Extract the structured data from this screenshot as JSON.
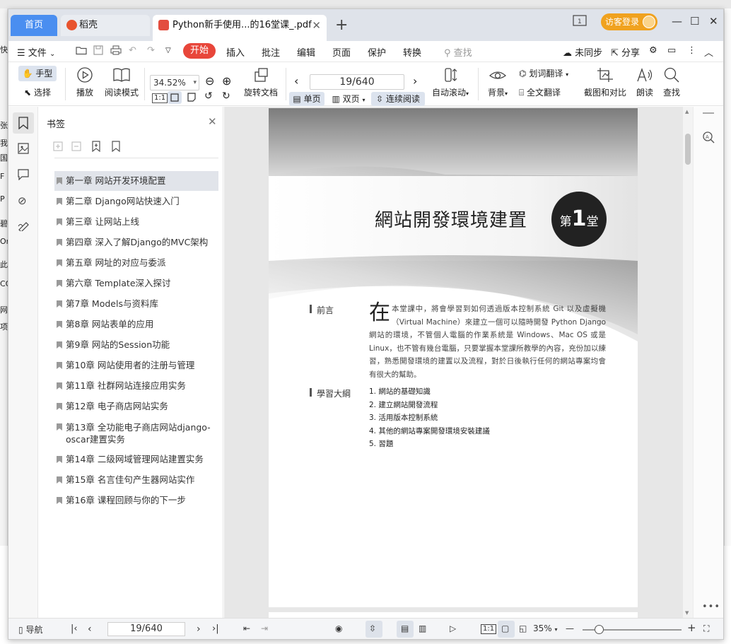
{
  "desktop": {
    "left_chars": [
      "快",
      "张",
      "我",
      "国",
      "F",
      "P",
      "碧",
      "Or",
      "此",
      "CO",
      "网",
      "项"
    ]
  },
  "tabs": [
    {
      "label": "首页"
    },
    {
      "label": "稻壳"
    },
    {
      "label": "Python新手使用...的16堂课_.pdf"
    }
  ],
  "title_bar": {
    "guest_login": "访客登录"
  },
  "menu": {
    "file": "文件",
    "start": "开始",
    "items": [
      "插入",
      "批注",
      "编辑",
      "页面",
      "保护",
      "转换"
    ],
    "search": "查找",
    "unsynced": "未同步",
    "share": "分享"
  },
  "ribbon": {
    "hand": "手型",
    "select": "选择",
    "play": "播放",
    "read_mode": "阅读模式",
    "zoom": "34.52%",
    "rotate": "旋转文档",
    "page_indicator": "19/640",
    "single": "单页",
    "double": "双页",
    "continuous": "连续阅读",
    "auto_scroll": "自动滚动",
    "background": "背景",
    "word_translate": "划词翻译",
    "full_translate": "全文翻译",
    "screenshot_compare": "截图和对比",
    "read_aloud": "朗读",
    "find": "查找"
  },
  "bookmarks": {
    "title": "书签",
    "items": [
      "第一章 网站开发环境配置",
      "第二章 Django网站快速入门",
      "第三章 让网站上线",
      "第四章 深入了解Django的MVC架构",
      "第五章 网址的对应与委派",
      "第六章 Template深入探讨",
      "第7章 Models与资料库",
      "第8章 网站表单的应用",
      "第9章 网站的Session功能",
      "第10章 网站使用者的注册与管理",
      "第11章 社群网站连接应用实务",
      "第12章 电子商店网站实务",
      "第13章 全功能电子商店网站django-oscar建置实务",
      "第14章 二级网域管理网站建置实务",
      "第15章 名言佳句产生器网站实作",
      "第16章 课程回顾与你的下一步"
    ]
  },
  "page": {
    "chapter_title": "網站開發環境建置",
    "badge_prefix": "第",
    "badge_num": "1",
    "badge_suffix": "堂",
    "preface_label": "前言",
    "dropcap": "在",
    "intro": "本堂課中，將會學習到如何透過版本控制系統 Git 以及虛擬機（Virtual Machine）來建立一個可以隨時開發 Python Django 網站的環境，不管個人電腦的作業系統是 Windows、Mac OS 或是 Linux，也不管有幾台電腦，只要掌握本堂課所教學的內容，充份加以練習，熟悉開發環境的建置以及流程，對於日後執行任何的網站專案均會有很大的幫助。",
    "outline_label": "學習大綱",
    "outline": [
      "1. 網站的基礎知識",
      "2. 建立網站開發流程",
      "3. 活用版本控制系統",
      "4. 其他的網站專案開發環境安裝建議",
      "5. 習題"
    ]
  },
  "status": {
    "nav": "导航",
    "page": "19/640",
    "zoom": "35%"
  }
}
